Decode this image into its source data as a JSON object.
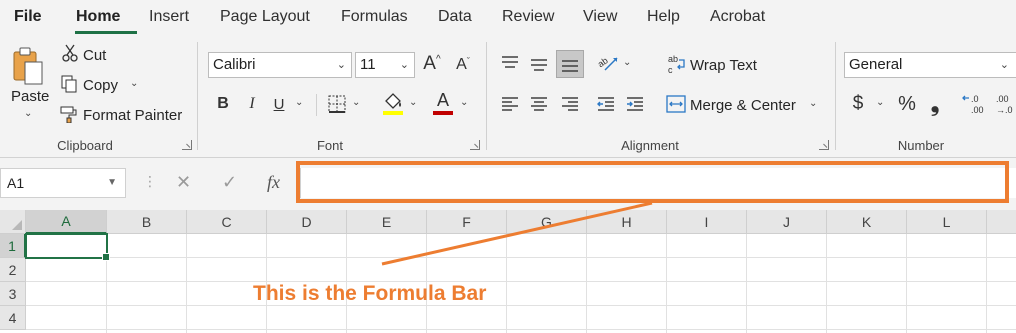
{
  "tabs": [
    "File",
    "Home",
    "Insert",
    "Page Layout",
    "Formulas",
    "Data",
    "Review",
    "View",
    "Help",
    "Acrobat"
  ],
  "clipboard": {
    "paste_label": "Paste",
    "cut_label": "Cut",
    "copy_label": "Copy",
    "format_painter_label": "Format Painter",
    "group_label": "Clipboard"
  },
  "font": {
    "name": "Calibri",
    "size": "11",
    "bold": "B",
    "italic": "I",
    "underline": "U",
    "color_letter": "A",
    "grow_label": "A",
    "shrink_label": "A",
    "group_label": "Font",
    "highlight_color": "#ffff00",
    "font_color": "#c00000"
  },
  "alignment": {
    "wrap_label": "Wrap Text",
    "merge_label": "Merge & Center",
    "group_label": "Alignment"
  },
  "number": {
    "format": "General",
    "currency": "$",
    "percent": "%",
    "comma": "❟",
    "group_label": "Number"
  },
  "formula_bar": {
    "name_box": "A1",
    "cancel": "✕",
    "enter": "✓",
    "fx": "fx",
    "value": ""
  },
  "grid": {
    "columns": [
      "A",
      "B",
      "C",
      "D",
      "E",
      "F",
      "G",
      "H",
      "I",
      "J",
      "K",
      "L"
    ],
    "rows": [
      "1",
      "2",
      "3",
      "4"
    ],
    "active_cell": "A1"
  },
  "annotation": {
    "text": "This is the Formula Bar",
    "color": "#ed7d31"
  }
}
